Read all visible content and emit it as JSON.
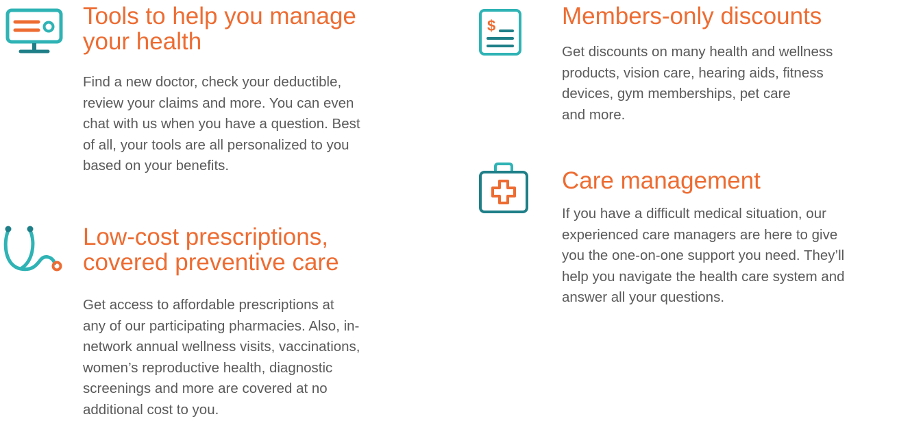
{
  "colors": {
    "heading": "#ed6c32",
    "body_text": "#5a5a5a",
    "teal": "#2fb3b5",
    "dark_teal": "#1f7f88",
    "orange": "#ed6c32"
  },
  "features": [
    {
      "icon": "computer-monitor-icon",
      "title": "Tools to help you manage\nyour health",
      "body": "Find a new doctor, check your deductible,\nreview your claims and more. You can even\nchat with us when you have a question. Best\nof all, your tools are all personalized to you\nbased on your benefits."
    },
    {
      "icon": "stethoscope-icon",
      "title": "Low-cost prescriptions,\ncovered preventive care",
      "body": "Get access to affordable prescriptions at\nany of our participating pharmacies. Also, in-\nnetwork annual wellness visits, vaccinations,\nwomen’s reproductive health, diagnostic\nscreenings and more are covered at no\nadditional cost to you."
    },
    {
      "icon": "dollar-receipt-icon",
      "title": "Members-only discounts",
      "body": "Get discounts on many health and wellness\nproducts, vision care, hearing aids, fitness\ndevices, gym memberships, pet care\nand more."
    },
    {
      "icon": "first-aid-kit-icon",
      "title": "Care management",
      "body": "If you have a difficult medical situation, our\nexperienced care managers are here to give\nyou the one-on-one support you need. They’ll\nhelp you navigate the health care system and\nanswer all your questions."
    }
  ]
}
